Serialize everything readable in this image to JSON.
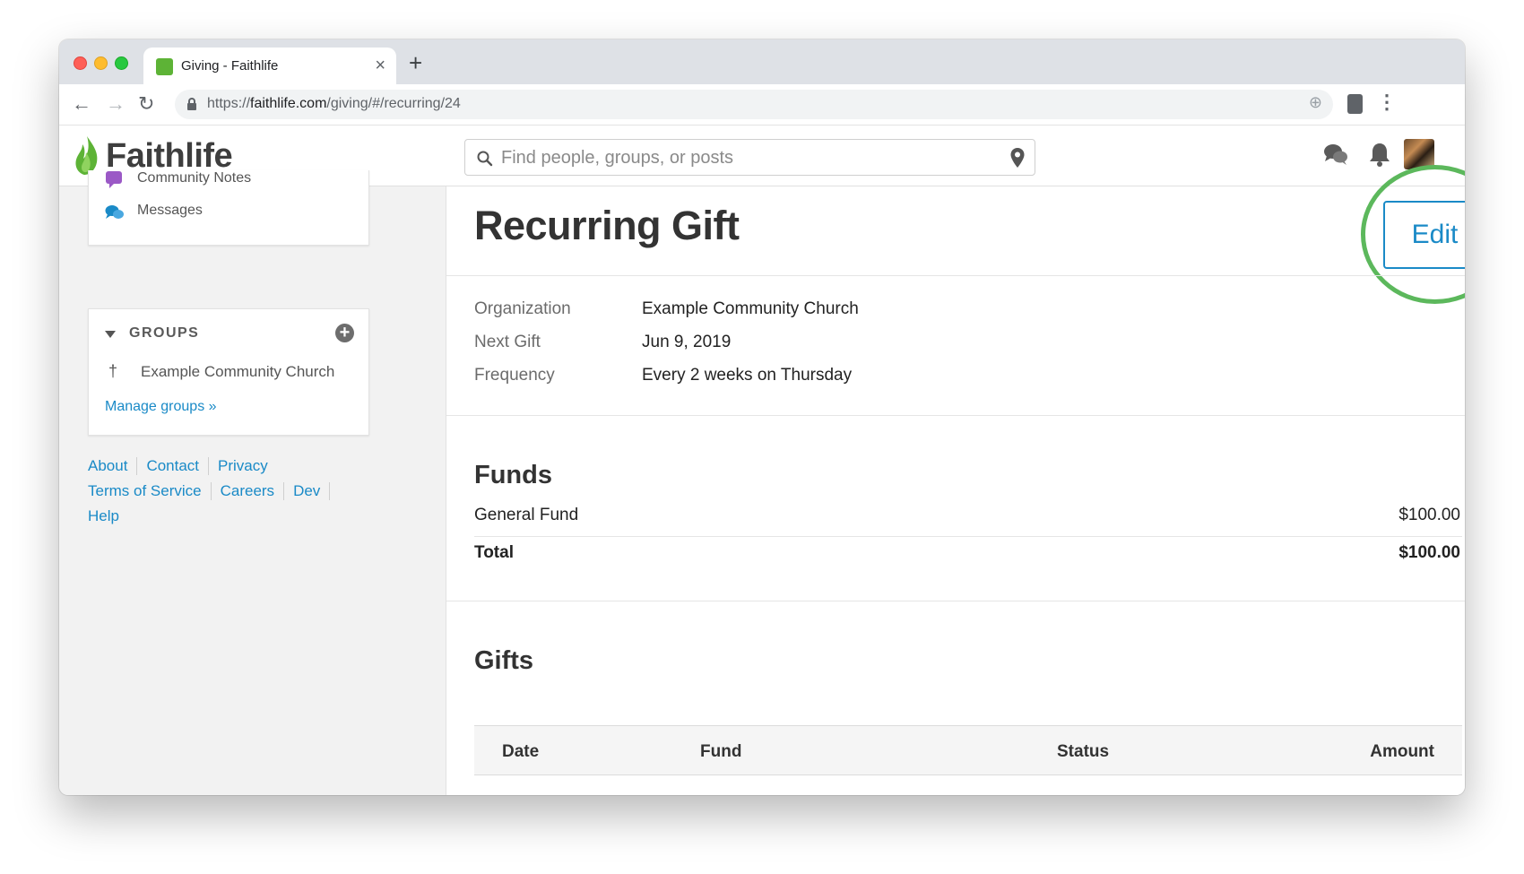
{
  "browser": {
    "tab_title": "Giving - Faithlife",
    "tab_close": "×",
    "new_tab": "+",
    "url_scheme": "https://",
    "url_host": "faithlife.com",
    "url_path": "/giving/#/recurring/24",
    "nav_back": "←",
    "nav_forward": "→",
    "nav_reload": "↻",
    "zoom": "⊕",
    "menu": "⋮"
  },
  "header": {
    "logo": "Faithlife",
    "search_placeholder": "Find people, groups, or posts"
  },
  "sidebar": {
    "nav_items": [
      {
        "label": "Community Notes",
        "icon": "speech-bubble-icon"
      },
      {
        "label": "Messages",
        "icon": "messages-icon"
      }
    ],
    "groups_title": "GROUPS",
    "add_symbol": "+",
    "groups": [
      {
        "label": "Example Community Church",
        "symbol": "†"
      }
    ],
    "manage_groups": "Manage groups »",
    "footer_links": {
      "row1": [
        "About",
        "Contact",
        "Privacy"
      ],
      "row2": [
        "Terms of Service",
        "Careers",
        "Dev"
      ],
      "row3": [
        "Help"
      ]
    }
  },
  "main": {
    "title": "Recurring Gift",
    "edit_label": "Edit",
    "details": [
      {
        "label": "Organization",
        "value": "Example Community Church"
      },
      {
        "label": "Next Gift",
        "value": "Jun 9, 2019"
      },
      {
        "label": "Frequency",
        "value": "Every 2 weeks on Thursday"
      }
    ],
    "funds_heading": "Funds",
    "funds": [
      {
        "name": "General Fund",
        "amount": "$100.00"
      }
    ],
    "total_label": "Total",
    "total_amount": "$100.00",
    "gifts_heading": "Gifts",
    "gifts_columns": [
      "Date",
      "Fund",
      "Status",
      "Amount"
    ]
  },
  "colors": {
    "accent": "#1a8ac7",
    "highlight": "#5cb85c",
    "logo_green": "#5db336"
  }
}
